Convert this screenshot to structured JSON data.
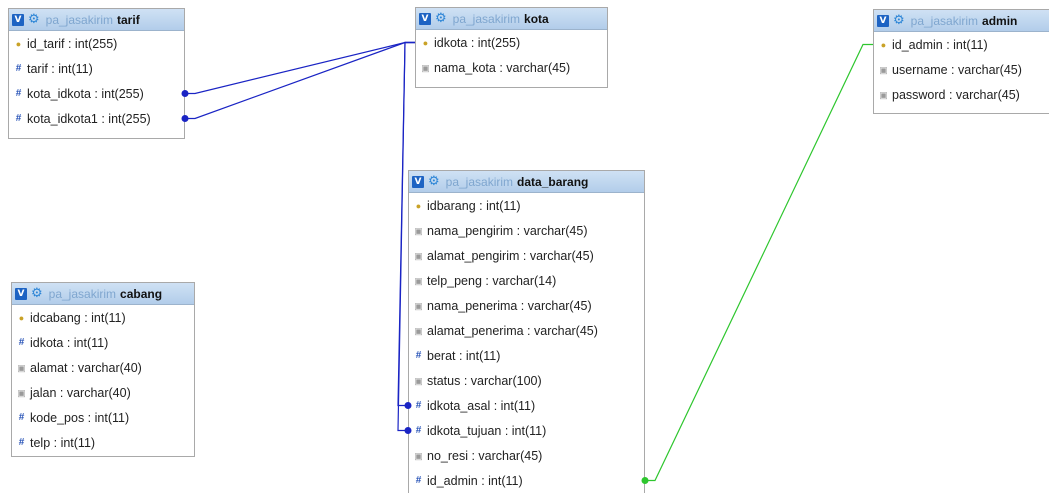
{
  "colors": {
    "header_top": "#cfe1f4",
    "header_bottom": "#b2cdea",
    "db_name": "#7fa6cf",
    "relation_blue": "#1a24c4",
    "relation_green": "#2ec62e",
    "key_icon": "#c9a227",
    "number_icon": "#2b56b8",
    "text_icon": "#9a9a9a"
  },
  "icons": {
    "toggle": "V",
    "gear": "⚙",
    "key": "●",
    "number": "#",
    "text": "▣"
  },
  "tables": [
    {
      "id": "tarif",
      "db": "pa_jasakirim",
      "name": "tarif",
      "columns": [
        {
          "label": "id_tarif : int(255)",
          "kind": "key"
        },
        {
          "label": "tarif : int(11)",
          "kind": "number"
        },
        {
          "label": "kota_idkota : int(255)",
          "kind": "number"
        },
        {
          "label": "kota_idkota1 : int(255)",
          "kind": "number"
        }
      ]
    },
    {
      "id": "kota",
      "db": "pa_jasakirim",
      "name": "kota",
      "columns": [
        {
          "label": "idkota : int(255)",
          "kind": "key"
        },
        {
          "label": "nama_kota : varchar(45)",
          "kind": "text"
        }
      ]
    },
    {
      "id": "admin",
      "db": "pa_jasakirim",
      "name": "admin",
      "columns": [
        {
          "label": "id_admin : int(11)",
          "kind": "key"
        },
        {
          "label": "username : varchar(45)",
          "kind": "text"
        },
        {
          "label": "password : varchar(45)",
          "kind": "text"
        }
      ]
    },
    {
      "id": "data_barang",
      "db": "pa_jasakirim",
      "name": "data_barang",
      "columns": [
        {
          "label": "idbarang : int(11)",
          "kind": "key"
        },
        {
          "label": "nama_pengirim : varchar(45)",
          "kind": "text"
        },
        {
          "label": "alamat_pengirim : varchar(45)",
          "kind": "text"
        },
        {
          "label": "telp_peng : varchar(14)",
          "kind": "text"
        },
        {
          "label": "nama_penerima : varchar(45)",
          "kind": "text"
        },
        {
          "label": "alamat_penerima : varchar(45)",
          "kind": "text"
        },
        {
          "label": "berat : int(11)",
          "kind": "number"
        },
        {
          "label": "status : varchar(100)",
          "kind": "text"
        },
        {
          "label": "idkota_asal : int(11)",
          "kind": "number"
        },
        {
          "label": "idkota_tujuan : int(11)",
          "kind": "number"
        },
        {
          "label": "no_resi : varchar(45)",
          "kind": "text"
        },
        {
          "label": "id_admin : int(11)",
          "kind": "number"
        }
      ]
    },
    {
      "id": "cabang",
      "db": "pa_jasakirim",
      "name": "cabang",
      "columns": [
        {
          "label": "idcabang : int(11)",
          "kind": "key"
        },
        {
          "label": "idkota : int(11)",
          "kind": "number"
        },
        {
          "label": "alamat : varchar(40)",
          "kind": "text"
        },
        {
          "label": "jalan : varchar(40)",
          "kind": "text"
        },
        {
          "label": "kode_pos : int(11)",
          "kind": "number"
        },
        {
          "label": "telp : int(11)",
          "kind": "number"
        }
      ]
    }
  ],
  "relations": [
    {
      "from_table": "tarif",
      "from_column": "kota_idkota",
      "to_table": "kota",
      "to_column": "idkota",
      "color": "#1a24c4"
    },
    {
      "from_table": "tarif",
      "from_column": "kota_idkota1",
      "to_table": "kota",
      "to_column": "idkota",
      "color": "#1a24c4"
    },
    {
      "from_table": "data_barang",
      "from_column": "idkota_asal",
      "to_table": "kota",
      "to_column": "idkota",
      "color": "#1a24c4"
    },
    {
      "from_table": "data_barang",
      "from_column": "idkota_tujuan",
      "to_table": "kota",
      "to_column": "idkota",
      "color": "#1a24c4"
    },
    {
      "from_table": "data_barang",
      "from_column": "id_admin",
      "to_table": "admin",
      "to_column": "id_admin",
      "color": "#2ec62e"
    }
  ]
}
